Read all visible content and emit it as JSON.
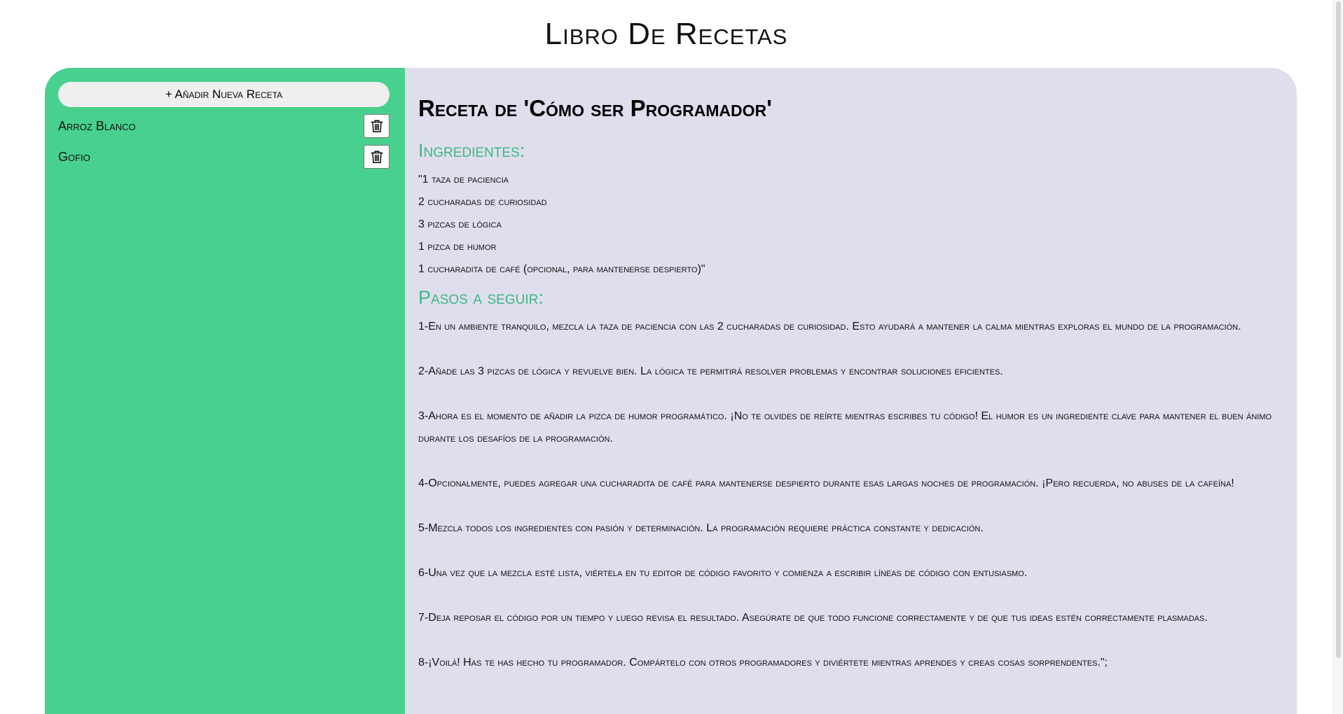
{
  "page": {
    "title": "Libro De Recetas"
  },
  "colors": {
    "sidebar_bg": "#48d18e",
    "panel_bg": "#dfdeed",
    "accent": "#3cb881"
  },
  "sidebar": {
    "add_button_label": "+ Añadir Nueva Receta",
    "recipes": [
      {
        "name": "Arroz Blanco",
        "delete_icon": "trash-icon"
      },
      {
        "name": "Gofio",
        "delete_icon": "trash-icon"
      }
    ]
  },
  "recipe": {
    "title": "Receta de 'Cómo ser Programador'",
    "ingredients_heading": "Ingredientes:",
    "ingredients": [
      "\"1 taza de paciencia",
      "2 cucharadas de curiosidad",
      "3 pizcas de lógica",
      "1 pizca de humor",
      "1 cucharadita de café (opcional, para mantenerse despierto)\""
    ],
    "steps_heading": "Pasos a seguir:",
    "steps": [
      "1-En un ambiente tranquilo, mezcla la taza de paciencia con las 2 cucharadas de curiosidad. Esto ayudará a mantener la calma mientras exploras el mundo de la programación.",
      "2-Añade las 3 pizcas de lógica y revuelve bien. La lógica te permitirá resolver problemas y encontrar soluciones eficientes.",
      "3-Ahora es el momento de añadir la pizca de humor programático. ¡No te olvides de reírte mientras escribes tu código! El humor es un ingrediente clave para mantener el buen ánimo durante los desafíos de la programación.",
      "4-Opcionalmente, puedes agregar una cucharadita de café para mantenerse despierto durante esas largas noches de programación. ¡Pero recuerda, no abuses de la cafeína!",
      "5-Mezcla todos los ingredientes con pasión y determinación. La programación requiere práctica constante y dedicación.",
      "6-Una vez que la mezcla esté lista, viértela en tu editor de código favorito y comienza a escribir líneas de código con entusiasmo.",
      "7-Deja reposar el código por un tiempo y luego revisa el resultado. Asegúrate de que todo funcione correctamente y de que tus ideas estén correctamente plasmadas.",
      "8-¡Voilà! Has te has hecho tu programador. Compártelo con otros programadores y diviértete mientras aprendes y creas cosas sorprendentes.\";"
    ]
  }
}
